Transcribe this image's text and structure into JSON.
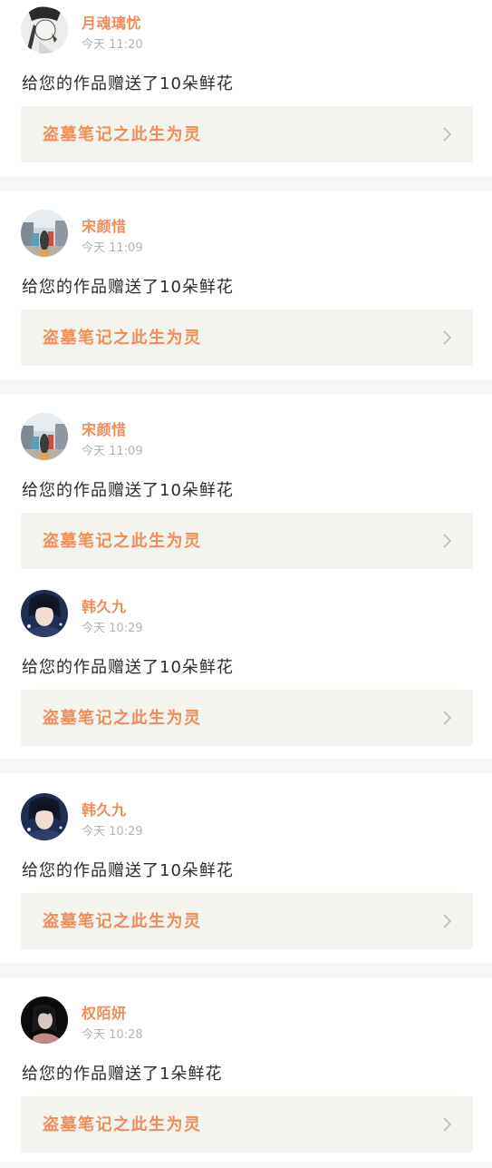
{
  "notifications": [
    {
      "username": "月魂璃忧",
      "time": "今天 11:20",
      "message": "给您的作品赠送了10朵鲜花",
      "work_title": "盗墓笔记之此生为灵",
      "avatar_icon": "avatar-sketch-girl-icon"
    },
    {
      "username": "宋颜惜",
      "time": "今天 11:09",
      "message": "给您的作品赠送了10朵鲜花",
      "work_title": "盗墓笔记之此生为灵",
      "avatar_icon": "avatar-street-photo-icon"
    },
    {
      "username": "宋颜惜",
      "time": "今天 11:09",
      "message": "给您的作品赠送了10朵鲜花",
      "work_title": "盗墓笔记之此生为灵",
      "avatar_icon": "avatar-street-photo-icon"
    },
    {
      "username": "韩久九",
      "time": "今天 10:29",
      "message": "给您的作品赠送了10朵鲜花",
      "work_title": "盗墓笔记之此生为灵",
      "avatar_icon": "avatar-portrait-man-icon"
    },
    {
      "username": "韩久九",
      "time": "今天 10:29",
      "message": "给您的作品赠送了10朵鲜花",
      "work_title": "盗墓笔记之此生为灵",
      "avatar_icon": "avatar-portrait-man-icon"
    },
    {
      "username": "权陌妍",
      "time": "今天 10:28",
      "message": "给您的作品赠送了1朵鲜花",
      "work_title": "盗墓笔记之此生为灵",
      "avatar_icon": "avatar-dark-portrait-icon"
    }
  ],
  "colors": {
    "accent": "#f08d5a",
    "card_bg": "#f4f4ee",
    "divider": "#f6f6f6",
    "time_text": "#b4b4b4"
  }
}
